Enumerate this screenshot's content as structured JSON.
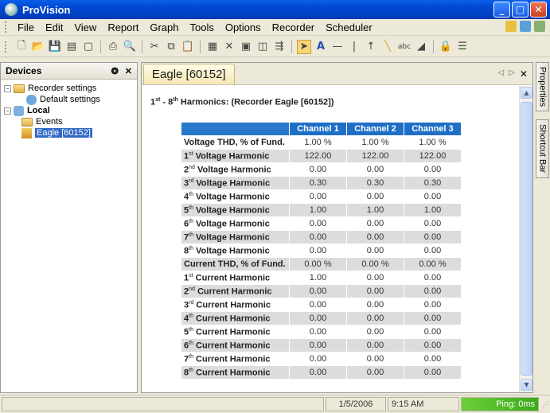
{
  "window": {
    "title": "ProVision"
  },
  "menu": [
    "File",
    "Edit",
    "View",
    "Report",
    "Graph",
    "Tools",
    "Options",
    "Recorder",
    "Scheduler"
  ],
  "devices_panel": {
    "title": "Devices",
    "pin_label": "❂",
    "close_label": "✕",
    "tree": [
      {
        "label": "Recorder settings",
        "level": 0,
        "expander": "−"
      },
      {
        "label": "Default settings",
        "level": 1
      },
      {
        "label": "Local",
        "level": 0,
        "expander": "−",
        "bold": true
      },
      {
        "label": "Events",
        "level": 1
      },
      {
        "label": "Eagle [60152]",
        "level": 1,
        "selected": true
      }
    ]
  },
  "document": {
    "tab_title": "Eagle [60152]",
    "heading_prefix_a": "1",
    "heading_sup_a": "st",
    "heading_mid": " - 8",
    "heading_sup_b": "th",
    "heading_rest": " Harmonics: (Recorder Eagle [60152])"
  },
  "harmonics_table": {
    "headers": [
      "Channel 1",
      "Channel 2",
      "Channel 3"
    ],
    "rows": [
      {
        "pre": "Voltage THD, % of Fund.",
        "sup": "",
        "post": "",
        "values": [
          "1.00 %",
          "1.00 %",
          "1.00 %"
        ]
      },
      {
        "pre": "1",
        "sup": "st",
        "post": " Voltage Harmonic",
        "values": [
          "122.00",
          "122.00",
          "122.00"
        ]
      },
      {
        "pre": "2",
        "sup": "nd",
        "post": " Voltage Harmonic",
        "values": [
          "0.00",
          "0.00",
          "0.00"
        ]
      },
      {
        "pre": "3",
        "sup": "rd",
        "post": " Voltage Harmonic",
        "values": [
          "0.30",
          "0.30",
          "0.30"
        ]
      },
      {
        "pre": "4",
        "sup": "th",
        "post": " Voltage Harmonic",
        "values": [
          "0.00",
          "0.00",
          "0.00"
        ]
      },
      {
        "pre": "5",
        "sup": "th",
        "post": " Voltage Harmonic",
        "values": [
          "1.00",
          "1.00",
          "1.00"
        ]
      },
      {
        "pre": "6",
        "sup": "th",
        "post": " Voltage Harmonic",
        "values": [
          "0.00",
          "0.00",
          "0.00"
        ]
      },
      {
        "pre": "7",
        "sup": "th",
        "post": " Voltage Harmonic",
        "values": [
          "0.00",
          "0.00",
          "0.00"
        ]
      },
      {
        "pre": "8",
        "sup": "th",
        "post": " Voltage Harmonic",
        "values": [
          "0.00",
          "0.00",
          "0.00"
        ]
      },
      {
        "pre": "Current THD, % of Fund.",
        "sup": "",
        "post": "",
        "values": [
          "0.00 %",
          "0.00 %",
          "0.00 %"
        ]
      },
      {
        "pre": "1",
        "sup": "st",
        "post": " Current Harmonic",
        "values": [
          "1.00",
          "0.00",
          "0.00"
        ]
      },
      {
        "pre": "2",
        "sup": "nd",
        "post": " Current Harmonic",
        "values": [
          "0.00",
          "0.00",
          "0.00"
        ]
      },
      {
        "pre": "3",
        "sup": "rd",
        "post": " Current Harmonic",
        "values": [
          "0.00",
          "0.00",
          "0.00"
        ]
      },
      {
        "pre": "4",
        "sup": "th",
        "post": " Current Harmonic",
        "values": [
          "0.00",
          "0.00",
          "0.00"
        ]
      },
      {
        "pre": "5",
        "sup": "th",
        "post": " Current Harmonic",
        "values": [
          "0.00",
          "0.00",
          "0.00"
        ]
      },
      {
        "pre": "6",
        "sup": "th",
        "post": " Current Harmonic",
        "values": [
          "0.00",
          "0.00",
          "0.00"
        ]
      },
      {
        "pre": "7",
        "sup": "th",
        "post": " Current Harmonic",
        "values": [
          "0.00",
          "0.00",
          "0.00"
        ]
      },
      {
        "pre": "8",
        "sup": "th",
        "post": " Current Harmonic",
        "values": [
          "0.00",
          "0.00",
          "0.00"
        ]
      }
    ]
  },
  "side_tabs": {
    "properties": "Properties",
    "shortcut_bar": "Shortcut Bar"
  },
  "status": {
    "date": "1/5/2006",
    "time": "9:15 AM",
    "ping": "Ping: 0ms"
  },
  "colors": {
    "header_blue": "#1f6fc6",
    "title_blue": "#0048d0",
    "ping_green": "#3ca91a"
  }
}
